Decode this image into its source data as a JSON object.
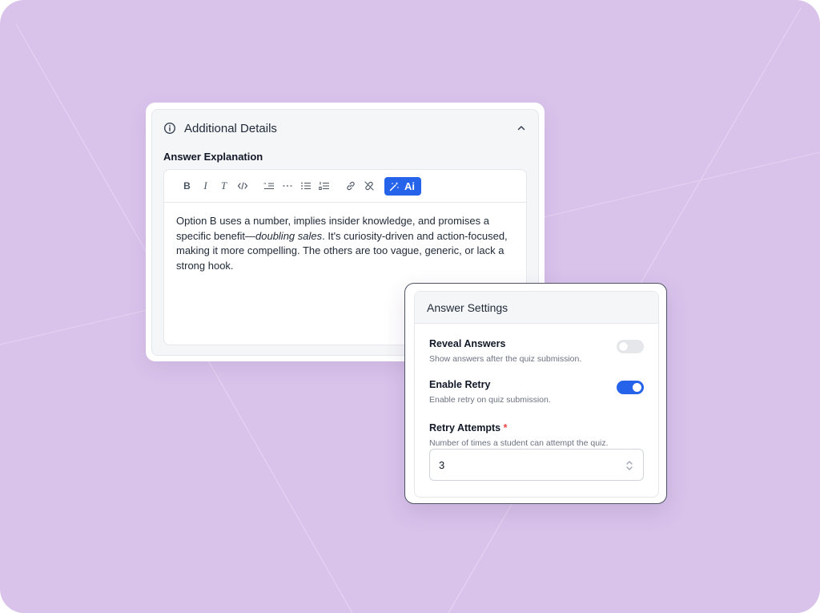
{
  "additional_details": {
    "title": "Additional Details",
    "field_label": "Answer Explanation",
    "toolbar": {
      "bold": "B",
      "italic": "I",
      "clear_format": "T",
      "ai_label": "Ai"
    },
    "explanation": {
      "text_before": "Option B uses a number, implies insider knowledge, and promises a specific benefit—",
      "text_italic": "doubling sales",
      "text_after": ". It's curiosity-driven and action-focused, making it more compelling. The others are too vague, generic, or lack a strong hook."
    }
  },
  "answer_settings": {
    "title": "Answer Settings",
    "reveal_answers": {
      "label": "Reveal Answers",
      "description": "Show answers after the quiz submission.",
      "enabled": false
    },
    "enable_retry": {
      "label": "Enable Retry",
      "description": "Enable retry on quiz submission.",
      "enabled": true
    },
    "retry_attempts": {
      "label": "Retry Attempts",
      "required_mark": "*",
      "description": "Number of times a student can attempt the quiz.",
      "value": "3"
    }
  },
  "colors": {
    "background": "#d9c3eb",
    "accent": "#2563eb",
    "required": "#ef4444"
  }
}
